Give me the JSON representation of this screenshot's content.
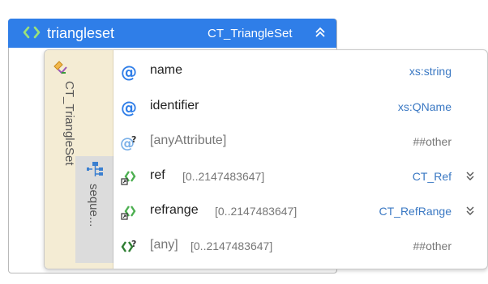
{
  "element": {
    "name": "triangleset",
    "type": "CT_TriangleSet",
    "header_color": "#2f7ee8"
  },
  "complex_type": {
    "label": "CT_TriangleSet",
    "sidebar_color": "#f4ecd4"
  },
  "sequence": {
    "label": "seque..."
  },
  "rows": [
    {
      "kind": "attribute",
      "icon": "at-icon",
      "name": "name",
      "occurs": "",
      "type": "xs:string",
      "expandable": false
    },
    {
      "kind": "attribute",
      "icon": "at-icon",
      "name": "identifier",
      "occurs": "",
      "type": "xs:QName",
      "expandable": false
    },
    {
      "kind": "any-attribute",
      "icon": "at-question-icon",
      "name": "[anyAttribute]",
      "occurs": "",
      "type": "##other",
      "expandable": false
    },
    {
      "kind": "element-ref",
      "icon": "element-ref-icon",
      "name": "ref",
      "occurs": "[0..2147483647]",
      "type": "CT_Ref",
      "expandable": true
    },
    {
      "kind": "element-ref",
      "icon": "element-ref-icon",
      "name": "refrange",
      "occurs": "[0..2147483647]",
      "type": "CT_RefRange",
      "expandable": true
    },
    {
      "kind": "any",
      "icon": "any-element-icon",
      "name": "[any]",
      "occurs": "[0..2147483647]",
      "type": "##other",
      "expandable": false
    }
  ]
}
